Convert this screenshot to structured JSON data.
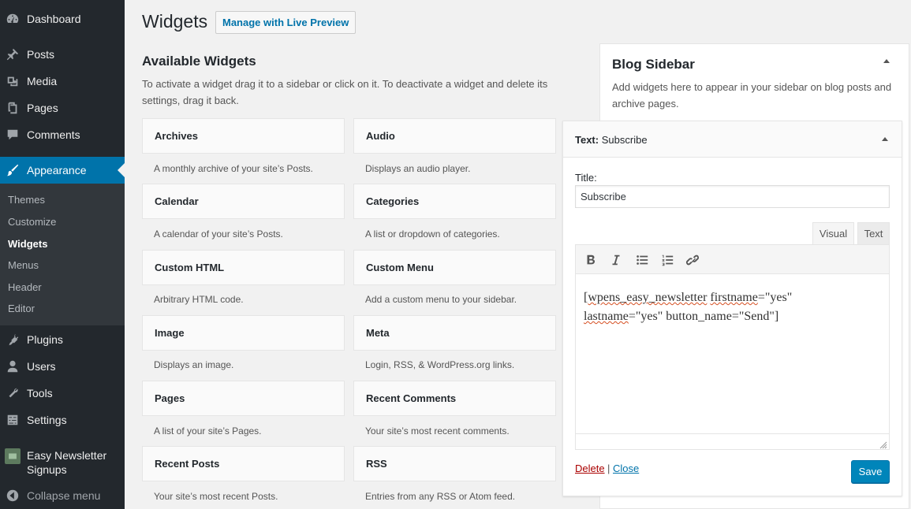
{
  "menu": {
    "dashboard": "Dashboard",
    "posts": "Posts",
    "media": "Media",
    "pages": "Pages",
    "comments": "Comments",
    "appearance": "Appearance",
    "plugins": "Plugins",
    "users": "Users",
    "tools": "Tools",
    "settings": "Settings",
    "easy_newsletter_line1": "Easy Newsletter",
    "easy_newsletter_line2": "Signups",
    "collapse": "Collapse menu"
  },
  "submenu": {
    "themes": "Themes",
    "customize": "Customize",
    "widgets": "Widgets",
    "menus": "Menus",
    "header": "Header",
    "editor": "Editor"
  },
  "page": {
    "title": "Widgets",
    "live_preview_button": "Manage with Live Preview",
    "available_title": "Available Widgets",
    "available_desc": "To activate a widget drag it to a sidebar or click on it. To deactivate a widget and delete its settings, drag it back."
  },
  "widgets": [
    {
      "name": "Archives",
      "desc": "A monthly archive of your site’s Posts."
    },
    {
      "name": "Audio",
      "desc": "Displays an audio player."
    },
    {
      "name": "Calendar",
      "desc": "A calendar of your site’s Posts."
    },
    {
      "name": "Categories",
      "desc": "A list or dropdown of categories."
    },
    {
      "name": "Custom HTML",
      "desc": "Arbitrary HTML code."
    },
    {
      "name": "Custom Menu",
      "desc": "Add a custom menu to your sidebar."
    },
    {
      "name": "Image",
      "desc": "Displays an image."
    },
    {
      "name": "Meta",
      "desc": "Login, RSS, & WordPress.org links."
    },
    {
      "name": "Pages",
      "desc": "A list of your site’s Pages."
    },
    {
      "name": "Recent Comments",
      "desc": "Your site’s most recent comments."
    },
    {
      "name": "Recent Posts",
      "desc": "Your site’s most recent Posts."
    },
    {
      "name": "RSS",
      "desc": "Entries from any RSS or Atom feed."
    }
  ],
  "sidebar": {
    "title": "Blog Sidebar",
    "desc": "Add widgets here to appear in your sidebar on blog posts and archive pages."
  },
  "text_widget": {
    "type_label": "Text:",
    "instance_title": "Subscribe",
    "title_label": "Title:",
    "title_value": "Subscribe",
    "tab_visual": "Visual",
    "tab_text": "Text",
    "content_part1": "wpens_easy_newsletter",
    "content_part2": "firstname",
    "content_part3": "=\"yes\"",
    "content_part4": "lastname",
    "content_part5": "=\"yes\" button_name=\"Send\"]",
    "delete_link": "Delete",
    "separator": "|",
    "close_link": "Close",
    "save_button": "Save"
  },
  "colors": {
    "admin_bar": "#23282d",
    "submenu_bg": "#32373c",
    "accent": "#0073aa",
    "save_button": "#0085ba",
    "delete_link": "#aa0000"
  }
}
